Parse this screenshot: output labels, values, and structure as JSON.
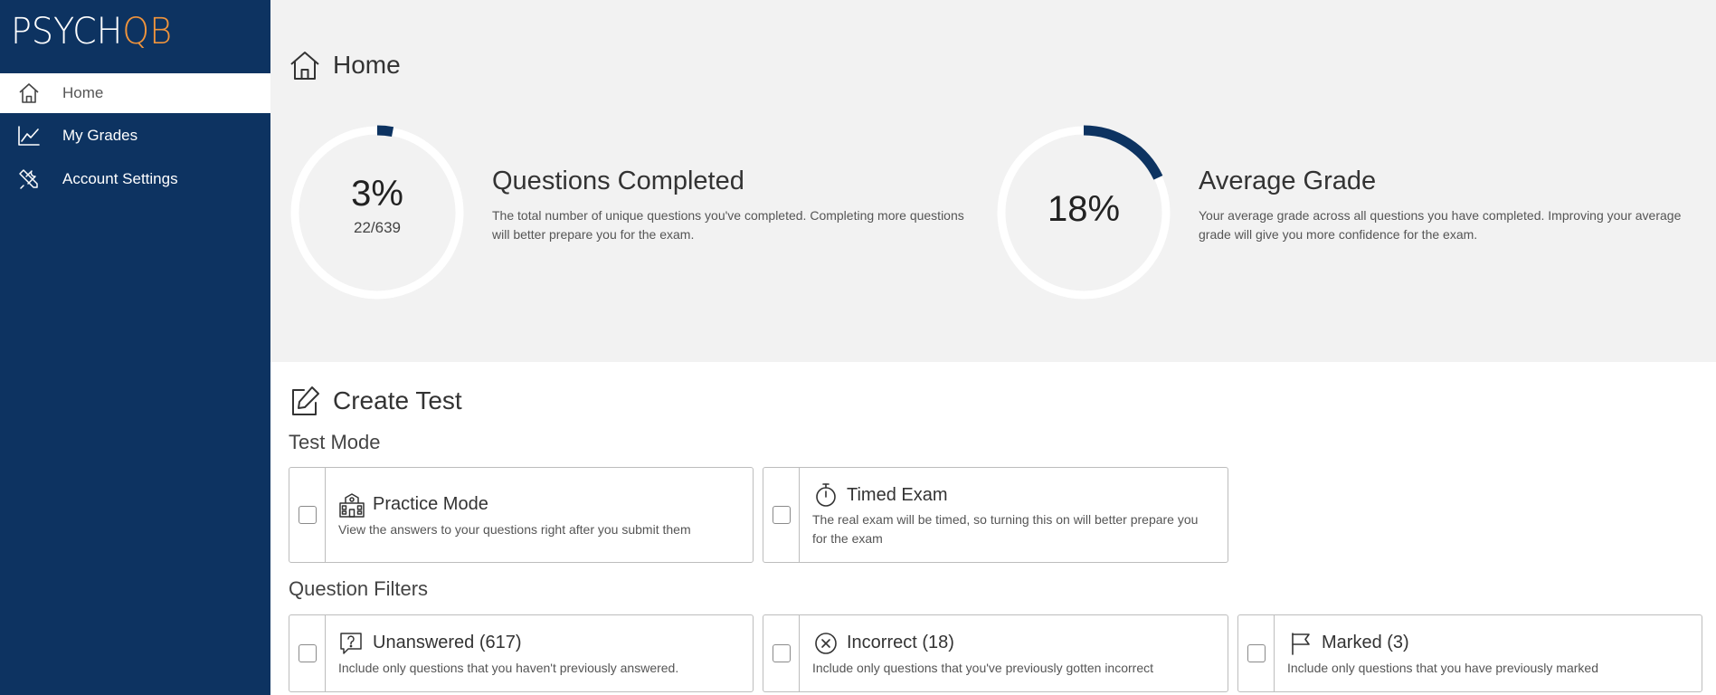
{
  "app": {
    "logo_main": "PSYCH",
    "logo_accent": "QB"
  },
  "sidebar": {
    "items": [
      {
        "label": "Home",
        "icon": "home-icon",
        "active": true
      },
      {
        "label": "My Grades",
        "icon": "chart-line-icon",
        "active": false
      },
      {
        "label": "Account Settings",
        "icon": "tools-icon",
        "active": false
      }
    ]
  },
  "home": {
    "title": "Home",
    "questions_completed": {
      "percent_text": "3%",
      "fraction_text": "22/639",
      "progress": 0.03,
      "title": "Questions Completed",
      "description_line1": "The total number of unique questions you've completed. Completing more questions",
      "description_line2": "will better prepare you for the exam."
    },
    "average_grade": {
      "percent_text": "18%",
      "progress": 0.18,
      "title": "Average Grade",
      "description_line1": "Your average grade across all questions you have completed. Improving your average",
      "description_line2": "grade will give you more confidence for the exam."
    }
  },
  "create_test": {
    "title": "Create Test",
    "test_mode_heading": "Test Mode",
    "modes": [
      {
        "title": "Practice Mode",
        "icon": "school-icon",
        "description_line1": "View the answers to your questions right after you submit them",
        "description_line2": ""
      },
      {
        "title": "Timed Exam",
        "icon": "stopwatch-icon",
        "description_line1": "The real exam will be timed, so turning this on will better prepare you",
        "description_line2": "for the exam"
      }
    ],
    "filters_heading": "Question Filters",
    "filters": [
      {
        "title": "Unanswered (617)",
        "icon": "question-bubble-icon",
        "description": "Include only questions that you haven't previously answered."
      },
      {
        "title": "Incorrect (18)",
        "icon": "x-circle-icon",
        "description": "Include only questions that you've previously gotten incorrect"
      },
      {
        "title": "Marked (3)",
        "icon": "flag-icon",
        "description": "Include only questions that you have previously marked"
      }
    ]
  },
  "colors": {
    "sidebar_bg": "#0d3361",
    "accent_orange": "#f0943c",
    "ring_fill": "#0d3361",
    "ring_track": "#ffffff",
    "top_bg": "#f2f2f2"
  }
}
